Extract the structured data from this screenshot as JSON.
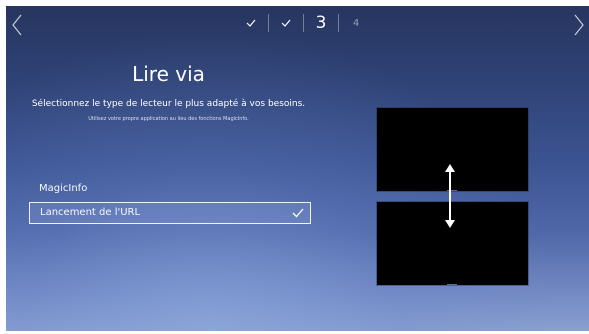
{
  "navigation": {
    "back_icon": "chevron-left-icon",
    "next_icon": "chevron-right-icon"
  },
  "steps": [
    {
      "state": "done",
      "icon": "checkmark-icon"
    },
    {
      "state": "done",
      "icon": "checkmark-icon"
    },
    {
      "state": "current",
      "label": "3"
    },
    {
      "state": "upcoming",
      "label": "4"
    }
  ],
  "page": {
    "title": "Lire via",
    "subtitle": "Sélectionnez le type de lecteur le plus adapté à vos besoins.",
    "hint": "Utilisez votre propre application au lieu des fonctions MagicInfo."
  },
  "options": [
    {
      "label": "MagicInfo",
      "selected": false
    },
    {
      "label": "Lancement de l'URL",
      "selected": true,
      "icon": "checkmark-icon"
    }
  ],
  "preview": {
    "panels": 2,
    "arrow_icon": "vertical-double-arrow-icon"
  },
  "colors": {
    "background_top": "#27355f",
    "background_bottom": "#8aa0d0",
    "text": "#ffffff",
    "preview_panel": "#000000"
  }
}
